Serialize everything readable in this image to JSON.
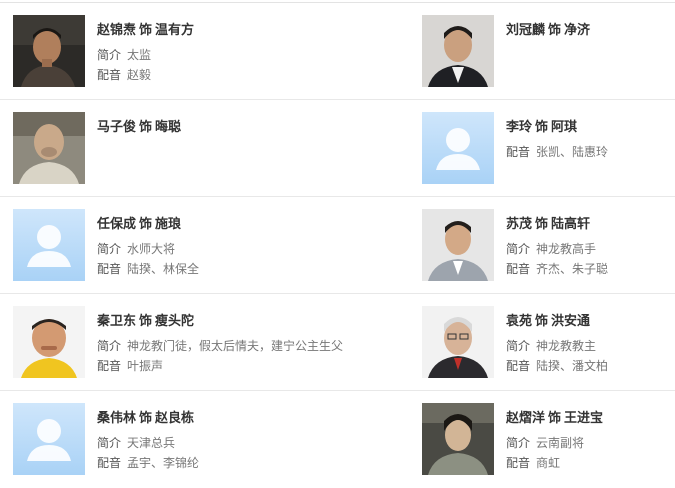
{
  "cast": [
    {
      "actor": "赵锦焘",
      "sep": "饰",
      "role": "温有方",
      "intro_label": "简介",
      "intro": "太监",
      "voice_label": "配音",
      "voice": "赵毅",
      "photo": "photo"
    },
    {
      "actor": "刘冠麟",
      "sep": "饰",
      "role": "净济",
      "intro_label": "",
      "intro": "",
      "voice_label": "",
      "voice": "",
      "photo": "photo"
    },
    {
      "actor": "马子俊",
      "sep": "饰",
      "role": "晦聪",
      "intro_label": "",
      "intro": "",
      "voice_label": "",
      "voice": "",
      "photo": "photo"
    },
    {
      "actor": "李玲",
      "sep": "饰",
      "role": "阿琪",
      "intro_label": "",
      "intro": "",
      "voice_label": "配音",
      "voice": "张凯、陆惠玲",
      "photo": "placeholder"
    },
    {
      "actor": "任保成",
      "sep": "饰",
      "role": "施琅",
      "intro_label": "简介",
      "intro": "水师大将",
      "voice_label": "配音",
      "voice": "陆揆、林保全",
      "photo": "placeholder"
    },
    {
      "actor": "苏茂",
      "sep": "饰",
      "role": "陆高轩",
      "intro_label": "简介",
      "intro": "神龙教高手",
      "voice_label": "配音",
      "voice": "齐杰、朱子聪",
      "photo": "photo"
    },
    {
      "actor": "秦卫东",
      "sep": "饰",
      "role": "瘦头陀",
      "intro_label": "简介",
      "intro": "神龙教门徒，假太后情夫，建宁公主生父",
      "voice_label": "配音",
      "voice": "叶振声",
      "photo": "photo"
    },
    {
      "actor": "袁苑",
      "sep": "饰",
      "role": "洪安通",
      "intro_label": "简介",
      "intro": "神龙教教主",
      "voice_label": "配音",
      "voice": "陆揆、潘文柏",
      "photo": "photo"
    },
    {
      "actor": "桑伟林",
      "sep": "饰",
      "role": "赵良栋",
      "intro_label": "简介",
      "intro": "天津总兵",
      "voice_label": "配音",
      "voice": "孟宇、李锦纶",
      "photo": "placeholder"
    },
    {
      "actor": "赵熠洋",
      "sep": "饰",
      "role": "王进宝",
      "intro_label": "简介",
      "intro": "云南副将",
      "voice_label": "配音",
      "voice": "商虹",
      "photo": "photo"
    }
  ]
}
